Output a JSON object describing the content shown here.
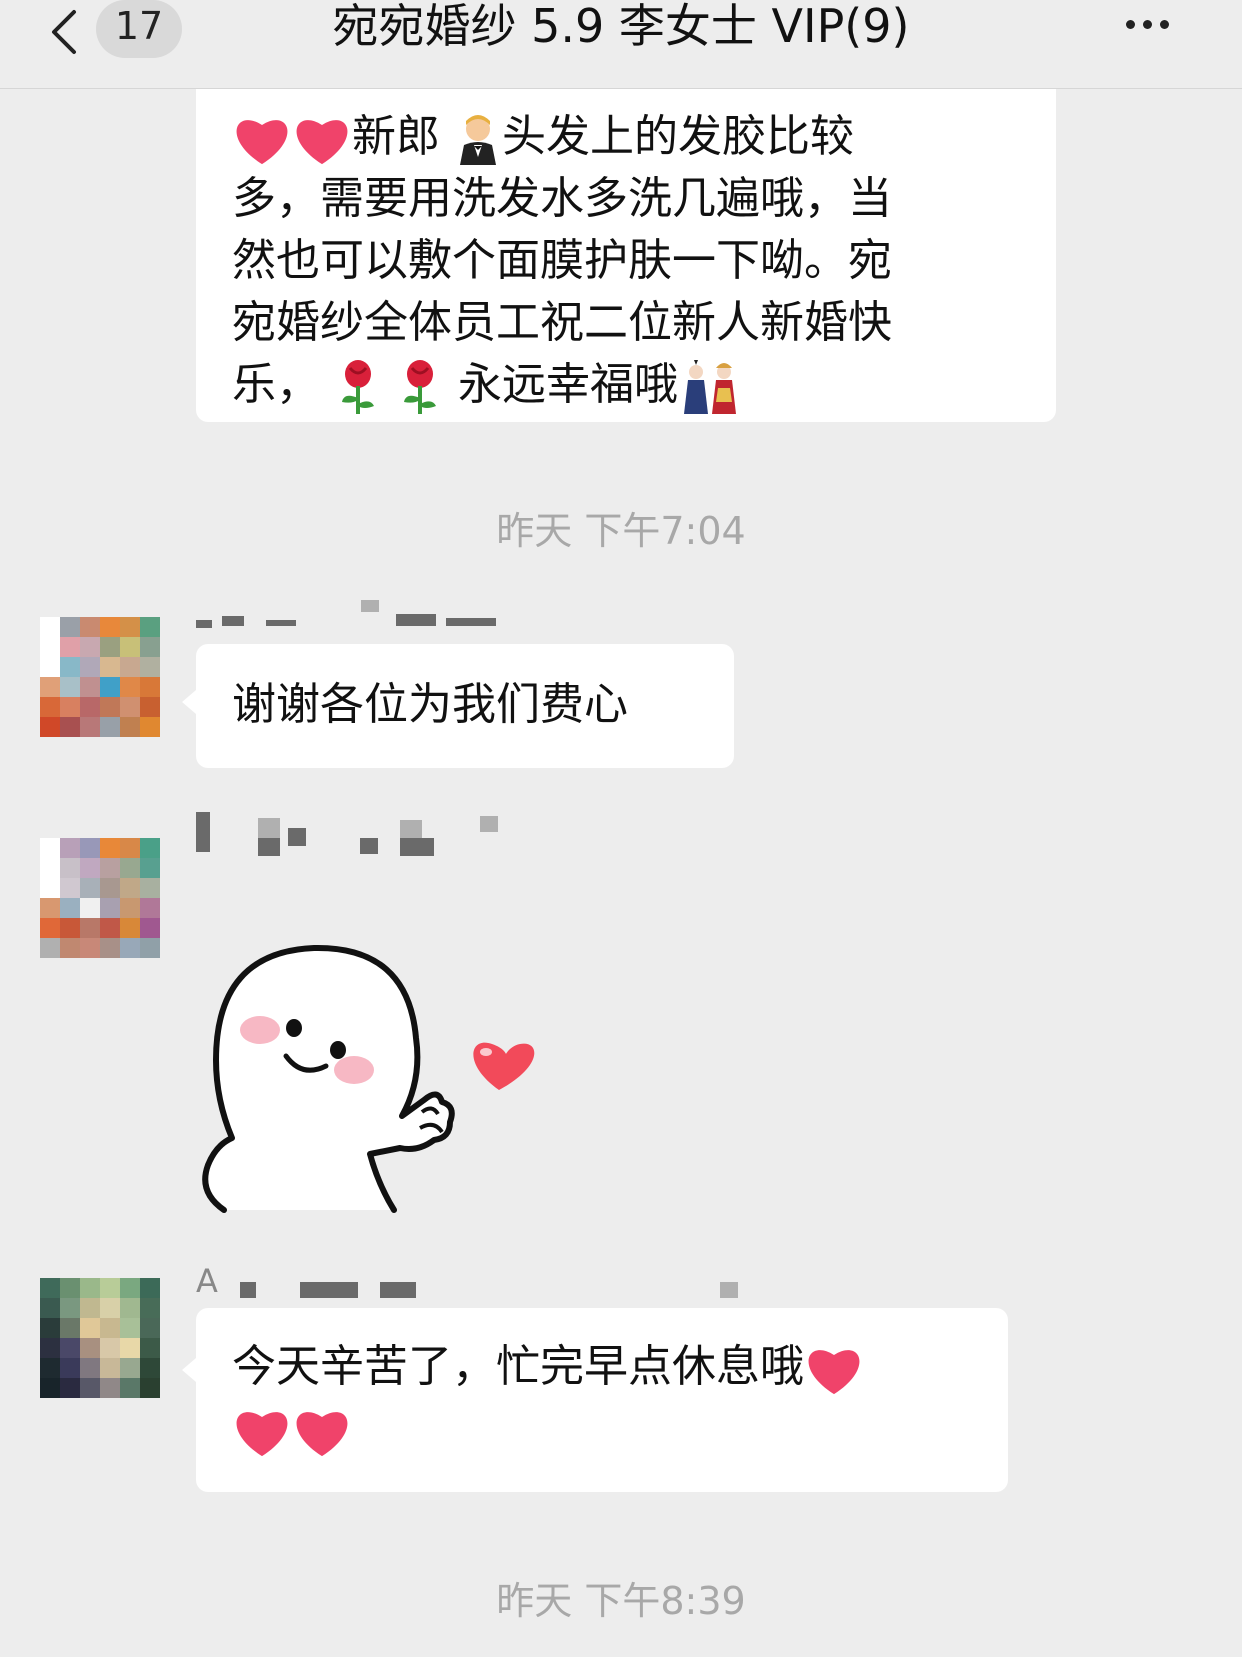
{
  "header": {
    "back_badge": "17",
    "title": "宛宛婚纱 5.9 李女士 VIP(9)"
  },
  "messages": {
    "m1_lines": [
      "新郎",
      "头发上的发胶比较",
      "多，需要用洗发水多洗几遍哦，当",
      "然也可以敷个面膜护肤一下呦。宛",
      "宛婚纱全体员工祝二位新人新婚快",
      "乐，",
      "永远幸福哦"
    ],
    "time1": "昨天 下午7:04",
    "m2": "谢谢各位为我们费心",
    "m4_sender_initial": "A",
    "m4_line1": "今天辛苦了，忙完早点休息哦",
    "time2": "昨天 下午8:39"
  },
  "colors": {
    "background": "#ededed",
    "bubble": "#ffffff",
    "heart": "#f0436a",
    "timestamp": "#a8a8a8"
  },
  "icons": [
    "back-icon",
    "more-icon",
    "heart-icon",
    "groom-icon",
    "rose-icon",
    "dolls-icon",
    "smiley-sticker"
  ]
}
